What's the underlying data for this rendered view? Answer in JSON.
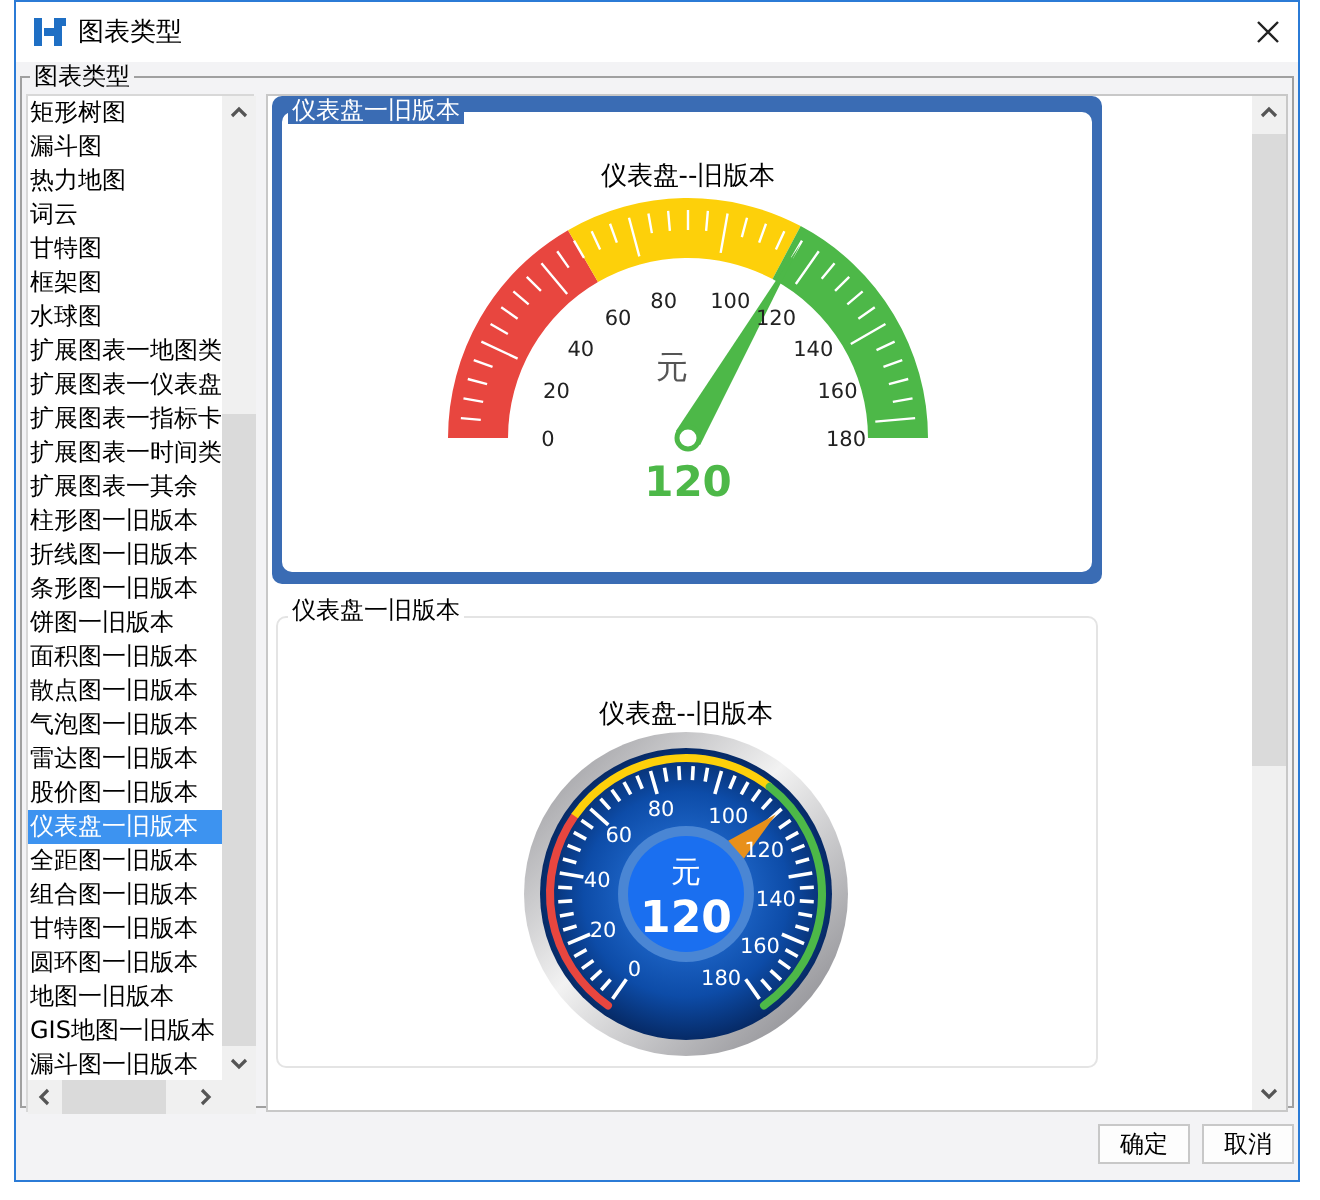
{
  "window": {
    "title": "图表类型"
  },
  "group_label": "图表类型",
  "chart_types": [
    {
      "label": "矩形树图",
      "selected": false
    },
    {
      "label": "漏斗图",
      "selected": false
    },
    {
      "label": "热力地图",
      "selected": false
    },
    {
      "label": "词云",
      "selected": false
    },
    {
      "label": "甘特图",
      "selected": false
    },
    {
      "label": "框架图",
      "selected": false
    },
    {
      "label": "水球图",
      "selected": false
    },
    {
      "label": "扩展图表一地图类",
      "selected": false
    },
    {
      "label": "扩展图表一仪表盘",
      "selected": false
    },
    {
      "label": "扩展图表一指标卡",
      "selected": false
    },
    {
      "label": "扩展图表一时间类",
      "selected": false
    },
    {
      "label": "扩展图表一其余",
      "selected": false
    },
    {
      "label": "柱形图一旧版本",
      "selected": false
    },
    {
      "label": "折线图一旧版本",
      "selected": false
    },
    {
      "label": "条形图一旧版本",
      "selected": false
    },
    {
      "label": "饼图一旧版本",
      "selected": false
    },
    {
      "label": "面积图一旧版本",
      "selected": false
    },
    {
      "label": "散点图一旧版本",
      "selected": false
    },
    {
      "label": "气泡图一旧版本",
      "selected": false
    },
    {
      "label": "雷达图一旧版本",
      "selected": false
    },
    {
      "label": "股价图一旧版本",
      "selected": false
    },
    {
      "label": "仪表盘一旧版本",
      "selected": true
    },
    {
      "label": "全距图一旧版本",
      "selected": false
    },
    {
      "label": "组合图一旧版本",
      "selected": false
    },
    {
      "label": "甘特图一旧版本",
      "selected": false
    },
    {
      "label": "圆环图一旧版本",
      "selected": false
    },
    {
      "label": "地图一旧版本",
      "selected": false
    },
    {
      "label": "GIS地图一旧版本",
      "selected": false
    },
    {
      "label": "漏斗图一旧版本",
      "selected": false
    }
  ],
  "previews": [
    {
      "label": "仪表盘一旧版本",
      "selected": true,
      "kind": "semicircle",
      "title": "仪表盘--旧版本",
      "unit": "元",
      "value": "120",
      "level": 0.667,
      "scale": [
        "0",
        "20",
        "40",
        "60",
        "80",
        "100",
        "120",
        "140",
        "160",
        "180"
      ]
    },
    {
      "label": "仪表盘一旧版本",
      "selected": false,
      "kind": "dial",
      "title": "仪表盘--旧版本",
      "unit": "元",
      "value": "120",
      "level": 0.667,
      "scale": [
        "0",
        "20",
        "40",
        "60",
        "80",
        "100",
        "120",
        "140",
        "160",
        "180"
      ]
    }
  ],
  "buttons": [
    "确定",
    "取消"
  ]
}
